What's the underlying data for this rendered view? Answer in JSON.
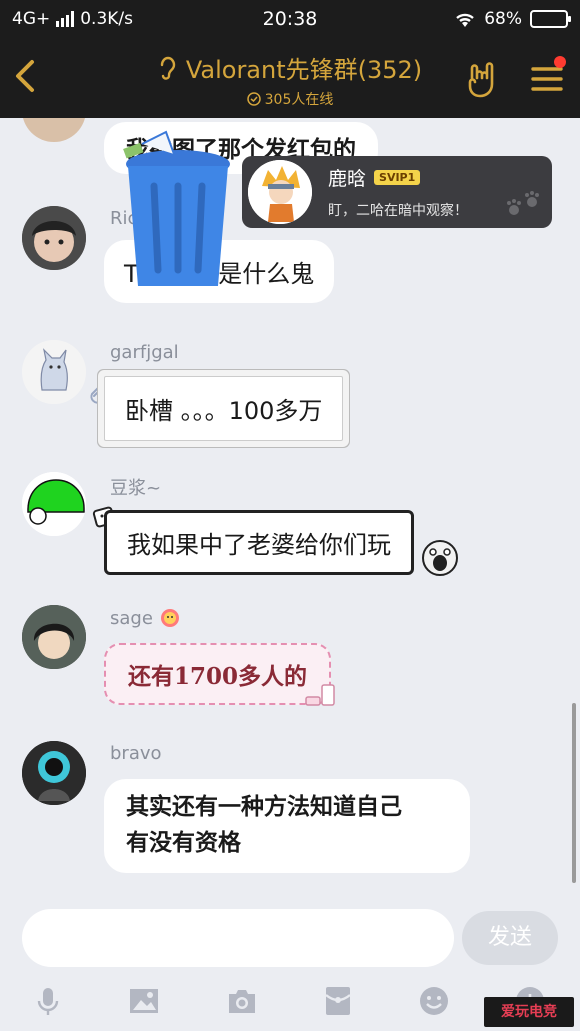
{
  "status_bar": {
    "network": "4G+",
    "speed": "0.3K/s",
    "time": "20:38",
    "battery": "68%"
  },
  "header": {
    "title": "Valorant先锋群(352)",
    "online": "305人在线",
    "accent": "#d4a53c"
  },
  "messages": [
    {
      "name": "",
      "text": "我截图了那个发红包的"
    },
    {
      "name": "Ric",
      "text": "T                然全掉是什么鬼"
    },
    {
      "name": "garfjgal",
      "text": "卧槽 。。。100多万"
    },
    {
      "name": "豆浆~",
      "text": "我如果中了老婆给你们玩"
    },
    {
      "name": "sage",
      "text": "还有1700多人的"
    },
    {
      "name": "bravo",
      "text_line1": "其实还有一种方法知道自己",
      "text_line2": "有没有资格"
    }
  ],
  "popup": {
    "name": "鹿晗",
    "badge": "SVIP1",
    "text": "盯，二哈在暗中观察！"
  },
  "input": {
    "placeholder": "",
    "send_label": "发送"
  },
  "watermark": "爱玩电竞"
}
